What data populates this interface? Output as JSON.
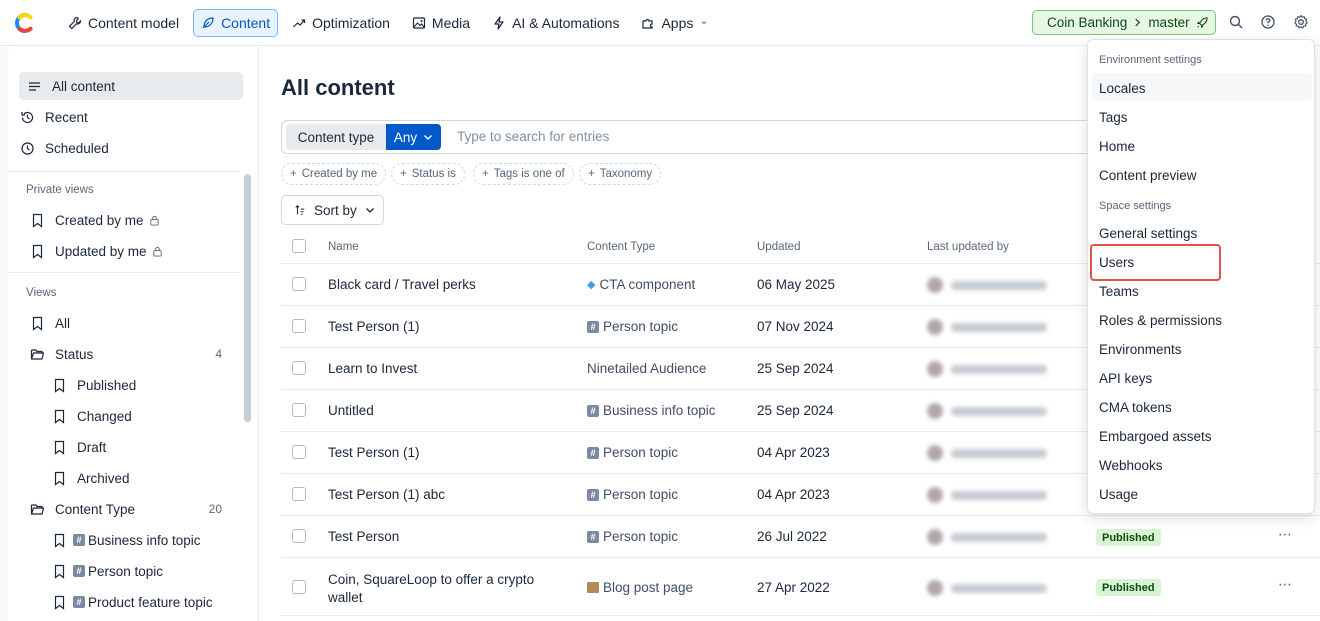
{
  "nav": {
    "items": [
      {
        "label": "Content model",
        "icon": "wrench-icon"
      },
      {
        "label": "Content",
        "icon": "feather-icon",
        "active": true
      },
      {
        "label": "Optimization",
        "icon": "trend-icon"
      },
      {
        "label": "Media",
        "icon": "image-icon"
      },
      {
        "label": "AI & Automations",
        "icon": "lightning-icon"
      },
      {
        "label": "Apps",
        "icon": "puzzle-icon"
      }
    ],
    "space": "Coin Banking",
    "environment": "master"
  },
  "sidebar": {
    "main": [
      {
        "label": "All content"
      },
      {
        "label": "Recent"
      },
      {
        "label": "Scheduled"
      }
    ],
    "private_header": "Private views",
    "private": [
      {
        "label": "Created by me"
      },
      {
        "label": "Updated by me"
      }
    ],
    "views_header": "Views",
    "all": "All",
    "status": {
      "label": "Status",
      "count": "4"
    },
    "status_items": [
      "Published",
      "Changed",
      "Draft",
      "Archived"
    ],
    "content_type": {
      "label": "Content Type",
      "count": "20"
    },
    "content_type_items": [
      "Business info topic",
      "Person topic",
      "Product feature topic"
    ]
  },
  "main": {
    "title": "All content",
    "content_type_label": "Content type",
    "any_label": "Any",
    "search_placeholder": "Type to search for entries",
    "filters": [
      "Created by me",
      "Status is",
      "Tags is one of",
      "Taxonomy"
    ],
    "sort_label": "Sort by",
    "columns": {
      "name": "Name",
      "content_type": "Content Type",
      "updated": "Updated",
      "last_updated_by": "Last updated by"
    },
    "rows": [
      {
        "name": "Black card / Travel perks",
        "type": "CTA component",
        "icon": "gem",
        "updated": "06 May 2025"
      },
      {
        "name": "Test Person (1)",
        "type": "Person topic",
        "icon": "hash",
        "updated": "07 Nov 2024"
      },
      {
        "name": "Learn to Invest",
        "type": "Ninetailed Audience",
        "icon": "",
        "updated": "25 Sep 2024"
      },
      {
        "name": "Untitled",
        "type": "Business info topic",
        "icon": "hash",
        "updated": "25 Sep 2024"
      },
      {
        "name": "Test Person (1)",
        "type": "Person topic",
        "icon": "hash",
        "updated": "04 Apr 2023"
      },
      {
        "name": "Test Person (1) abc",
        "type": "Person topic",
        "icon": "hash",
        "updated": "04 Apr 2023"
      },
      {
        "name": "Test Person",
        "type": "Person topic",
        "icon": "hash",
        "updated": "26 Jul 2022",
        "status": "Published"
      },
      {
        "name": "Coin, SquareLoop to offer a crypto wallet",
        "type": "Blog post page",
        "icon": "book",
        "updated": "27 Apr 2022",
        "status": "Published"
      }
    ]
  },
  "menu": {
    "env_header": "Environment settings",
    "env_items": [
      "Locales",
      "Tags",
      "Home",
      "Content preview"
    ],
    "space_header": "Space settings",
    "space_items": [
      "General settings",
      "Users",
      "Teams",
      "Roles & permissions",
      "Environments",
      "API keys",
      "CMA tokens",
      "Embargoed assets",
      "Webhooks",
      "Usage"
    ]
  },
  "colors": {
    "accent": "#0059c8",
    "highlight": "#e0524a",
    "env_green": "#e6f7e4"
  }
}
